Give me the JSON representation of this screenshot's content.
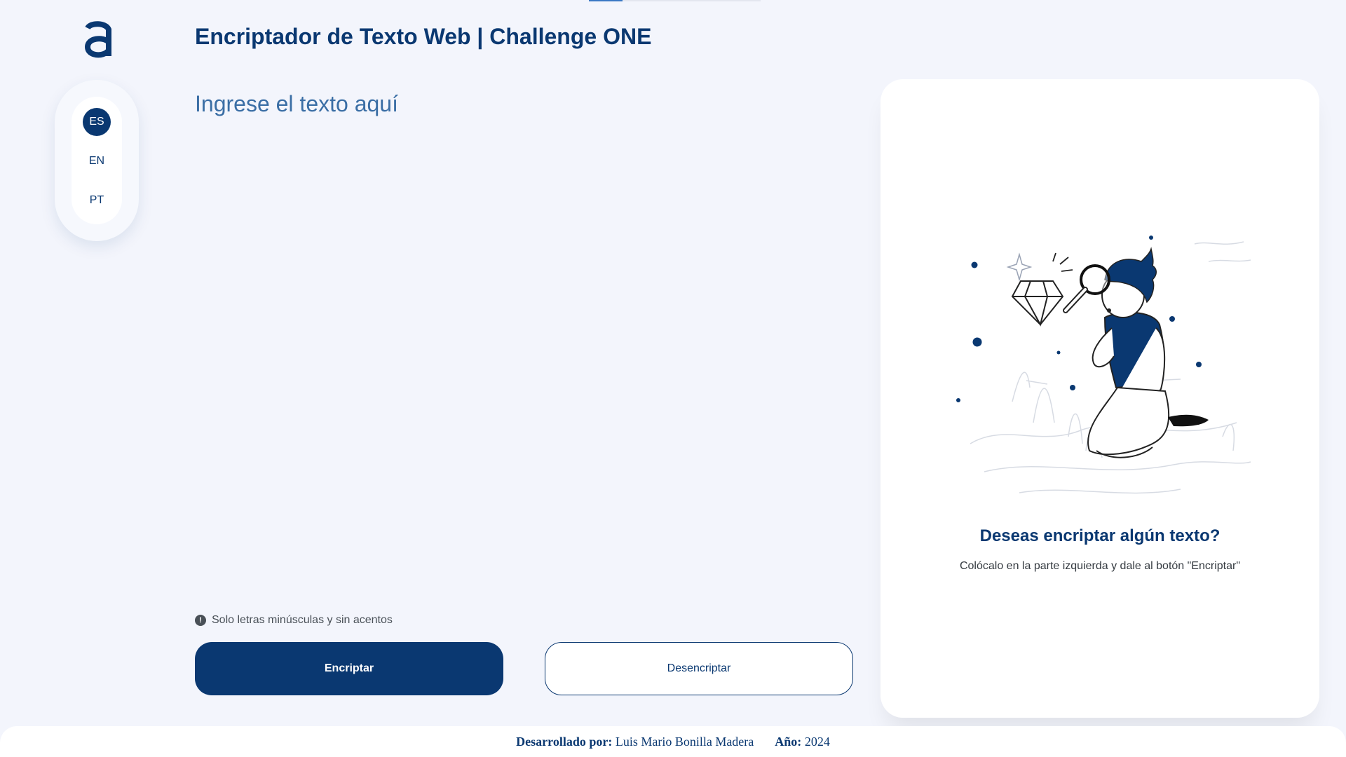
{
  "header": {
    "title": "Encriptador de Texto Web | Challenge ONE",
    "logo_icon": "alura-logo-icon"
  },
  "languages": {
    "items": [
      {
        "label": "ES",
        "active": true
      },
      {
        "label": "EN",
        "active": false
      },
      {
        "label": "PT",
        "active": false
      }
    ]
  },
  "input": {
    "placeholder": "Ingrese el texto aquí",
    "value": ""
  },
  "hint": {
    "icon": "exclamation-circle-icon",
    "text": "Solo letras minúsculas y sin acentos"
  },
  "buttons": {
    "encrypt": "Encriptar",
    "decrypt": "Desencriptar"
  },
  "output": {
    "illustration": "person-with-magnifier-illustration",
    "title": "Deseas encriptar algún texto?",
    "subtitle": "Colócalo en la parte izquierda y dale al botón \"Encriptar\""
  },
  "footer": {
    "dev_label": "Desarrollado por:",
    "dev_name": "Luis Mario Bonilla Madera",
    "year_label": "Año:",
    "year_value": "2024"
  },
  "colors": {
    "primary": "#0a3871",
    "background": "#f3f5fc",
    "card": "#ffffff"
  }
}
